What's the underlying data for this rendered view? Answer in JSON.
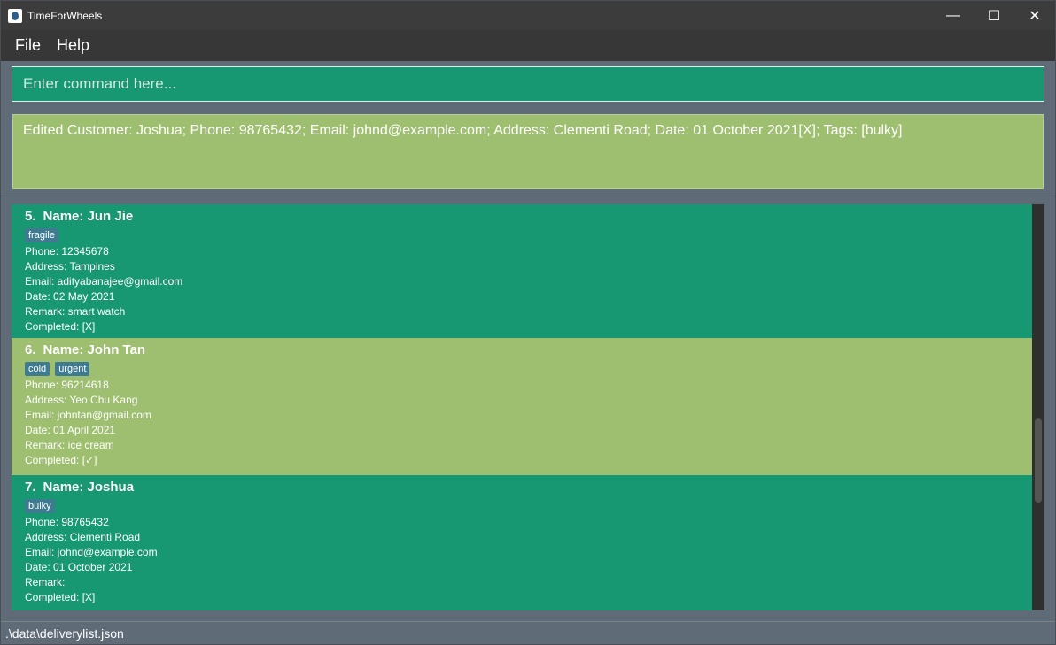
{
  "window": {
    "title": "TimeForWheels"
  },
  "window_controls": {
    "minimize": "—",
    "maximize": "☐",
    "close": "✕"
  },
  "menu": {
    "file": "File",
    "help": "Help"
  },
  "command": {
    "placeholder": "Enter command here..."
  },
  "result": {
    "text": "Edited Customer: Joshua; Phone: 98765432; Email: johnd@example.com; Address: Clementi Road; Date: 01 October 2021[X]; Tags: [bulky]"
  },
  "customers": [
    {
      "index": "5.",
      "name": "Name: Jun Jie",
      "tags": [
        "fragile"
      ],
      "phone": "Phone: 12345678",
      "address": "Address: Tampines",
      "email": "Email: adityabanajee@gmail.com",
      "date": "Date: 02 May 2021",
      "remark": "Remark: smart watch",
      "completed": "Completed: [X]"
    },
    {
      "index": "6.",
      "name": "Name: John Tan",
      "tags": [
        "cold",
        "urgent"
      ],
      "phone": "Phone: 96214618",
      "address": "Address: Yeo Chu Kang",
      "email": "Email: johntan@gmail.com",
      "date": "Date: 01 April 2021",
      "remark": "Remark: ice cream",
      "completed": "Completed: [✓]"
    },
    {
      "index": "7.",
      "name": "Name: Joshua",
      "tags": [
        "bulky"
      ],
      "phone": "Phone: 98765432",
      "address": "Address: Clementi Road",
      "email": "Email: johnd@example.com",
      "date": "Date: 01 October 2021",
      "remark": "Remark:",
      "completed": "Completed: [X]"
    }
  ],
  "status": {
    "path": ".\\data\\deliverylist.json"
  },
  "colors": {
    "card_green": "#179873",
    "card_olive": "#9ebf6f",
    "tag": "#3e7b91",
    "titlebar": "#3c3c3c",
    "menubar": "#373737",
    "background": "#606b78"
  }
}
